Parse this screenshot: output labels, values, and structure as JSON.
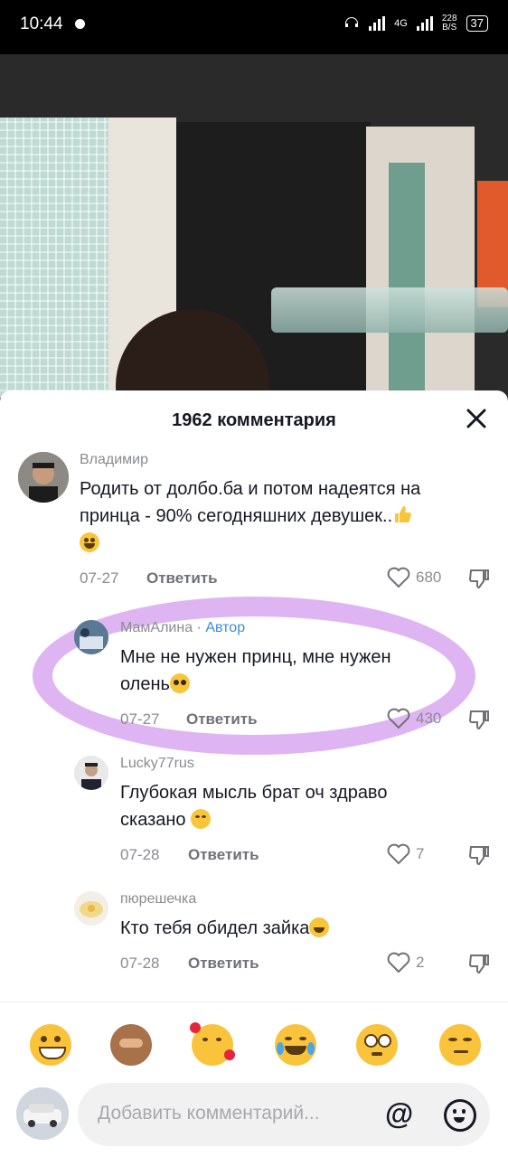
{
  "status_bar": {
    "time": "10:44",
    "network": "4G",
    "speed": "228",
    "speed_unit": "B/S",
    "battery": "37"
  },
  "sheet": {
    "title": "1962 комментария"
  },
  "comments": [
    {
      "username": "Владимир",
      "text_line1": "Родить от долбо.ба и потом надеятся на",
      "text_line2": "принца - 90% сегодняшних девушек..",
      "date": "07-27",
      "reply_label": "Ответить",
      "likes": "680"
    },
    {
      "username": "МамАлина",
      "author_label": "· Автор",
      "text_line1": "Мне не нужен принц, мне нужен",
      "text_line2": "олень",
      "date": "07-27",
      "reply_label": "Ответить",
      "likes": "430"
    },
    {
      "username": "Lucky77rus",
      "text_line1": "Глубокая мысль брат оч здраво",
      "text_line2": "сказано",
      "date": "07-28",
      "reply_label": "Ответить",
      "likes": "7"
    },
    {
      "username": "пюрешечка",
      "text_line1": "Кто тебя обидел зайка",
      "date": "07-28",
      "reply_label": "Ответить",
      "likes": "2"
    }
  ],
  "input": {
    "placeholder": "Добавить комментарий..."
  },
  "colors": {
    "accent_author": "#3c8ed8",
    "highlight": "#d8a8f0"
  },
  "emoji_bar": [
    "grinning-emoji",
    "monkey-emoji",
    "hearts-face-emoji",
    "tears-of-joy-emoji",
    "flushed-emoji",
    "smirk-emoji"
  ]
}
